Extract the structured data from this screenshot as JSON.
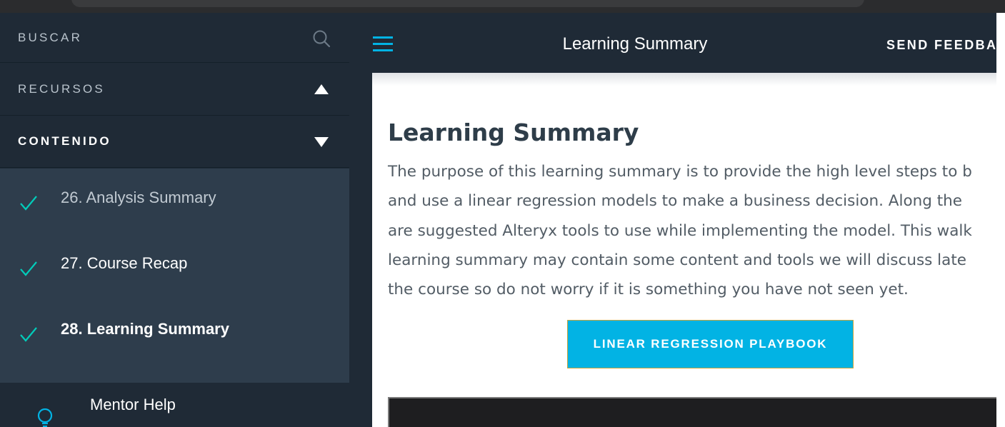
{
  "sidebar": {
    "search_label": "BUSCAR",
    "resources_label": "RECURSOS",
    "content_label": "CONTENIDO",
    "lessons": [
      {
        "label": "26. Analysis Summary",
        "completed": true
      },
      {
        "label": "27. Course Recap",
        "completed": true
      },
      {
        "label": "28. Learning Summary",
        "completed": true,
        "active": true
      }
    ],
    "mentor_label": "Mentor Help"
  },
  "header": {
    "title": "Learning Summary",
    "feedback_label": "SEND FEEDBA"
  },
  "main": {
    "heading": "Learning Summary",
    "paragraph_lines": [
      "The purpose of this learning summary is to provide the high level steps to b",
      "and use a linear regression models to make a business decision. Along the",
      "are suggested Alteryx tools to use while implementing the model. This walk",
      "learning summary may contain some content and tools we will discuss late",
      "the course so do not worry if it is something you have not seen yet."
    ],
    "button_label": "LINEAR REGRESSION PLAYBOOK"
  },
  "colors": {
    "sidebar_bg": "#1f2a36",
    "lessons_bg": "#2e3d4c",
    "accent": "#02b3e4",
    "heading": "#2e3d49",
    "body_text": "#525c65"
  },
  "icons": {
    "search": "search-icon",
    "resources_toggle": "triangle-up-icon",
    "content_toggle": "triangle-down-icon",
    "lesson_status": "checkmark-icon",
    "menu": "hamburger-menu-icon",
    "mentor": "lightbulb-icon"
  }
}
